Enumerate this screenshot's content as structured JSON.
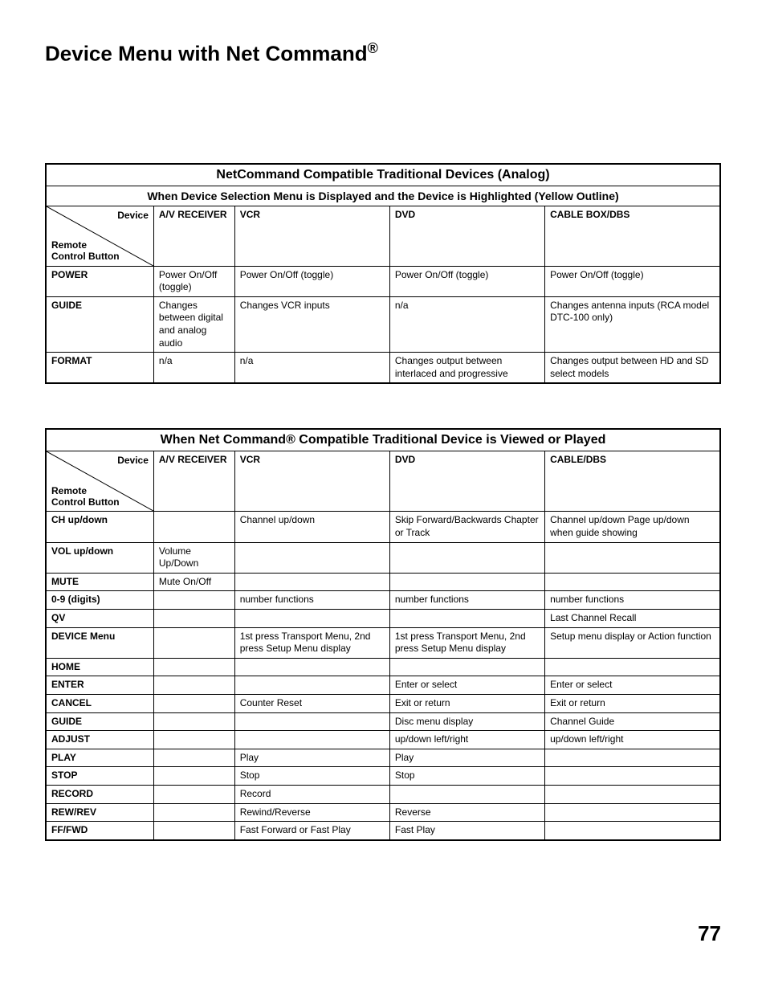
{
  "page_title": "Device Menu with Net Command",
  "page_title_sup": "®",
  "page_number": "77",
  "table1": {
    "title": "NetCommand Compatible Traditional Devices (Analog)",
    "subtitle": "When Device Selection Menu is Displayed and the Device is Highlighted (Yellow Outline)",
    "diag_top": "Device",
    "diag_bot_line1": "Remote",
    "diag_bot_line2": "Control Button",
    "cols": [
      "A/V RECEIVER",
      "VCR",
      "DVD",
      "CABLE BOX/DBS"
    ],
    "rows": [
      {
        "label": "POWER",
        "cells": [
          "Power On/Off (toggle)",
          "Power On/Off (toggle)",
          "Power On/Off (toggle)",
          "Power On/Off (toggle)"
        ]
      },
      {
        "label": "GUIDE",
        "cells": [
          "Changes between digital and analog audio",
          "Changes VCR inputs",
          "n/a",
          "Changes antenna inputs (RCA model DTC-100 only)"
        ]
      },
      {
        "label": "FORMAT",
        "cells": [
          "n/a",
          "n/a",
          "Changes output between interlaced and progressive",
          "Changes output between HD and SD select models"
        ]
      }
    ]
  },
  "table2": {
    "title": "When Net Command® Compatible Traditional Device is Viewed or Played",
    "diag_top": "Device",
    "diag_bot_line1": "Remote",
    "diag_bot_line2": "Control Button",
    "cols": [
      "A/V RECEIVER",
      "VCR",
      "DVD",
      "CABLE/DBS"
    ],
    "rows": [
      {
        "label": "CH up/down",
        "cells": [
          "",
          "Channel up/down",
          "Skip Forward/Backwards Chapter or Track",
          "Channel up/down Page up/down when guide showing"
        ]
      },
      {
        "label": "VOL up/down",
        "cells": [
          "Volume Up/Down",
          "",
          "",
          ""
        ]
      },
      {
        "label": "MUTE",
        "cells": [
          "Mute On/Off",
          "",
          "",
          ""
        ]
      },
      {
        "label": "0-9 (digits)",
        "cells": [
          "",
          "number functions",
          "number functions",
          "number functions"
        ]
      },
      {
        "label": "QV",
        "cells": [
          "",
          "",
          "",
          "Last Channel Recall"
        ]
      },
      {
        "label": "DEVICE Menu",
        "cells": [
          "",
          "1st press Transport Menu, 2nd press Setup Menu display",
          "1st press Transport Menu, 2nd press Setup Menu display",
          "Setup menu display or Action function"
        ]
      },
      {
        "label": "HOME",
        "cells": [
          "",
          "",
          "",
          ""
        ]
      },
      {
        "label": "ENTER",
        "cells": [
          "",
          "",
          "Enter or select",
          "Enter or select"
        ]
      },
      {
        "label": "CANCEL",
        "cells": [
          "",
          "Counter Reset",
          "Exit or return",
          "Exit or return"
        ]
      },
      {
        "label": "GUIDE",
        "cells": [
          "",
          "",
          "Disc menu display",
          "Channel Guide"
        ]
      },
      {
        "label": "ADJUST",
        "cells": [
          "",
          "",
          "up/down left/right",
          "up/down left/right"
        ]
      },
      {
        "label": "PLAY",
        "cells": [
          "",
          "Play",
          "Play",
          ""
        ]
      },
      {
        "label": "STOP",
        "cells": [
          "",
          "Stop",
          "Stop",
          ""
        ]
      },
      {
        "label": "RECORD",
        "cells": [
          "",
          "Record",
          "",
          ""
        ]
      },
      {
        "label": "REW/REV",
        "cells": [
          "",
          "Rewind/Reverse",
          "Reverse",
          ""
        ]
      },
      {
        "label": "FF/FWD",
        "cells": [
          "",
          "Fast Forward or Fast Play",
          "Fast Play",
          ""
        ]
      }
    ]
  }
}
